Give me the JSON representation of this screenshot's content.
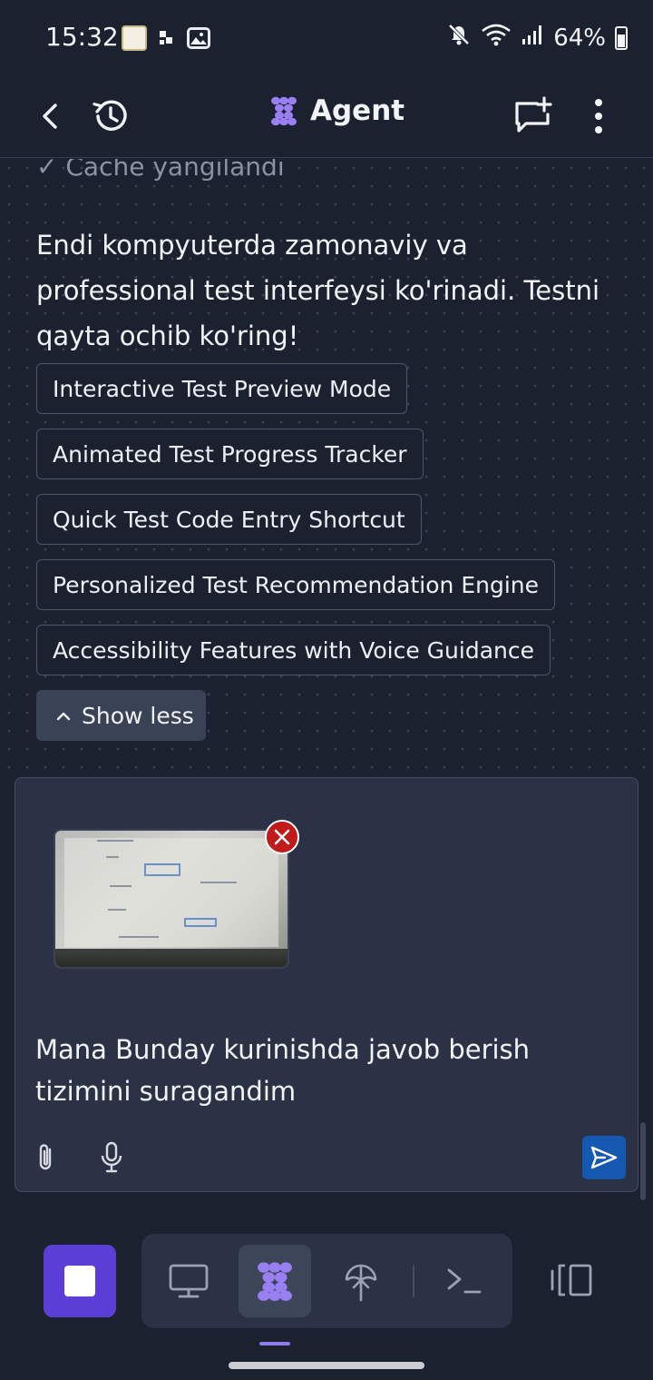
{
  "status_bar": {
    "time": "15:32",
    "battery": "64%",
    "icons": [
      "notification-avatar-icon",
      "notification-dots-icon",
      "gallery-icon",
      "mute-icon",
      "wifi-icon",
      "signal-icon",
      "battery-icon"
    ]
  },
  "header": {
    "title": "Agent",
    "icons": [
      "back-icon",
      "history-icon",
      "agent-logo-icon",
      "new-chat-icon",
      "more-icon"
    ]
  },
  "chat": {
    "faded_line": "✓ Cache yangilandi",
    "message": "Endi kompyuterda zamonaviy va professional test interfeysi ko'rinadi. Testni qayta ochib ko'ring!",
    "suggestions": [
      "Interactive Test Preview Mode",
      "Animated Test Progress Tracker",
      "Quick Test Code Entry Shortcut",
      "Personalized Test Recommendation Engine",
      "Accessibility Features with Voice Guidance"
    ],
    "show_less_label": "Show less"
  },
  "composer": {
    "text": "Mana Bunday kurinishda javob berish tizimini suragandim",
    "attachment_icon": "image-thumbnail",
    "icons": [
      "remove-attachment-icon",
      "paperclip-icon",
      "microphone-icon",
      "send-icon"
    ]
  },
  "bottom_nav": {
    "active_tool": "agent",
    "tools": [
      "stop-icon",
      "desktop-icon",
      "agent-icon",
      "deploy-icon",
      "terminal-icon",
      "layout-toggle-icon"
    ],
    "colors": {
      "accent": "#5b3ed6",
      "indicator": "#8e79f0",
      "send": "#1558b0"
    }
  }
}
